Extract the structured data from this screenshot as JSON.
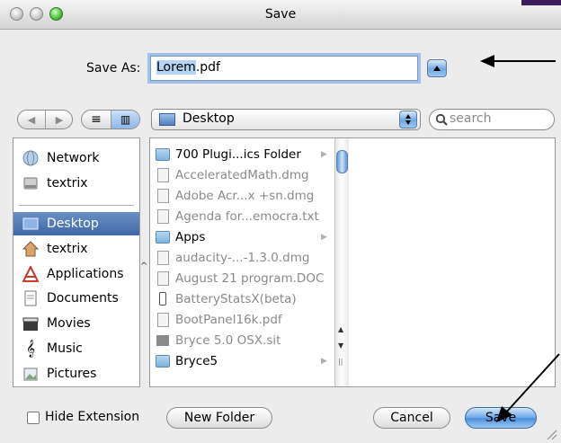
{
  "window": {
    "title": "Save"
  },
  "save_as": {
    "label": "Save As:",
    "value_selected": "Lorem",
    "value_rest": ".pdf"
  },
  "nav": {
    "back_icon": "back-arrow-icon",
    "forward_icon": "forward-arrow-icon"
  },
  "location": {
    "current": "Desktop"
  },
  "search": {
    "placeholder": "search"
  },
  "sidebar": {
    "items": [
      {
        "label": "Network",
        "icon": "globe-icon"
      },
      {
        "label": "textrix",
        "icon": "hard-disk-icon"
      },
      {
        "label": "Desktop",
        "icon": "desktop-icon",
        "selected": true
      },
      {
        "label": "textrix",
        "icon": "home-icon"
      },
      {
        "label": "Applications",
        "icon": "applications-icon"
      },
      {
        "label": "Documents",
        "icon": "documents-icon"
      },
      {
        "label": "Movies",
        "icon": "clapper-icon"
      },
      {
        "label": "Music",
        "icon": "music-note-icon"
      },
      {
        "label": "Pictures",
        "icon": "pictures-icon"
      }
    ]
  },
  "files": [
    {
      "name": "700 Plugi...ics Folder",
      "type": "folder",
      "enabled": true
    },
    {
      "name": "AcceleratedMath.dmg",
      "type": "file",
      "enabled": false
    },
    {
      "name": "Adobe Acr...x +sn.dmg",
      "type": "file",
      "enabled": false
    },
    {
      "name": "Agenda for...emocra.txt",
      "type": "file",
      "enabled": false
    },
    {
      "name": "Apps",
      "type": "folder",
      "enabled": true
    },
    {
      "name": "audacity-...-1.3.0.dmg",
      "type": "file",
      "enabled": false
    },
    {
      "name": "August 21 program.DOC",
      "type": "file",
      "enabled": false
    },
    {
      "name": "BatteryStatsX(beta)",
      "type": "file",
      "enabled": false
    },
    {
      "name": "BootPanel16k.pdf",
      "type": "file",
      "enabled": false
    },
    {
      "name": "Bryce 5.0 OSX.sit",
      "type": "file",
      "enabled": false
    },
    {
      "name": "Bryce5",
      "type": "folder",
      "enabled": true
    }
  ],
  "footer": {
    "hide_extension": "Hide Extension",
    "new_folder": "New Folder",
    "cancel": "Cancel",
    "save": "Save"
  },
  "colors": {
    "selection": "#3e68a8",
    "accent": "#6ca7e6"
  }
}
